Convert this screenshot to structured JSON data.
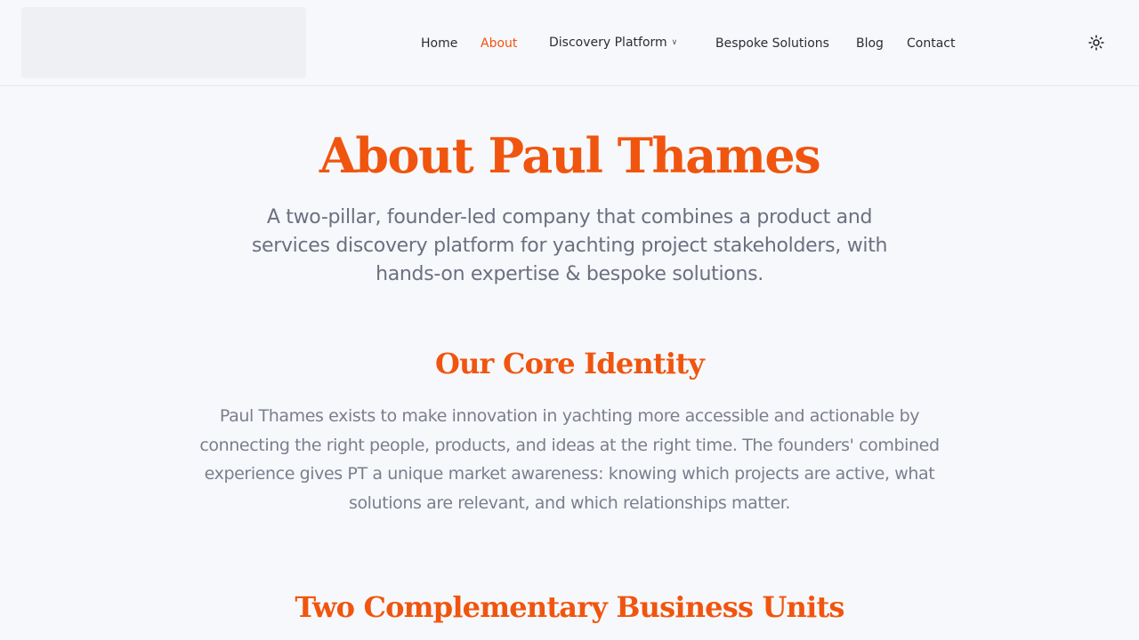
{
  "header": {
    "logo": "",
    "nav": {
      "home": "Home",
      "about": "About",
      "discovery": "Discovery Platform",
      "bespoke": "Bespoke Solutions",
      "blog": "Blog",
      "contact": "Contact"
    },
    "active_item": "About",
    "theme_toggle_icon": "sun-icon"
  },
  "hero": {
    "title": "About Paul Thames",
    "lead": "A two-pillar, founder-led company that combines a product and services discovery platform for yachting project stakeholders, with hands-on expertise & bespoke solutions."
  },
  "core_identity": {
    "heading": "Our Core Identity",
    "body": "Paul Thames exists to make innovation in yachting more accessible and actionable by connecting the right people, products, and ideas at the right time. The founders' combined experience gives PT a unique market awareness: knowing which projects are active, what solutions are relevant, and which relationships matter."
  },
  "business_units": {
    "heading": "Two Complementary Business Units"
  },
  "colors": {
    "accent": "#f0550f",
    "background": "#f7f8fb",
    "muted_text": "#7a7f8e"
  }
}
